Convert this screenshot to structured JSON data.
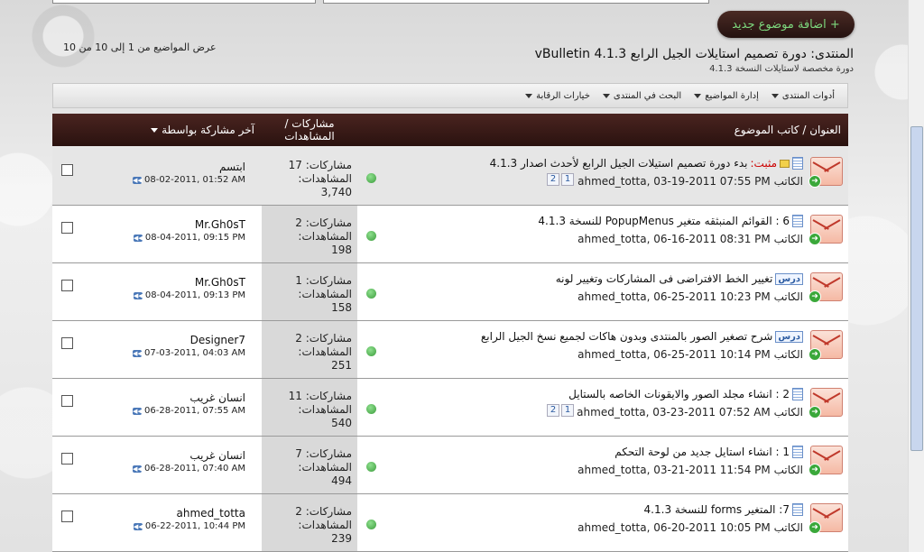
{
  "page": {
    "new_topic_label": "+ اضافة موضوع جديد",
    "forum_title": "المنتدى: دورة تصميم استايلات الجيل الرابع vBulletin 4.1.3",
    "forum_subtitle": "دورة مخصصة لاستايلات النسخة 4.1.3",
    "topic_count": "عرض المواضيع من 1 إلى 10 من 10"
  },
  "toolbar": {
    "items": [
      "أدوات المنتدى",
      "إدارة المواضيع",
      "البحث في المنتدى",
      "خيارات الرقابة"
    ]
  },
  "table": {
    "col_title": "العنوان / كاتب الموضوع",
    "col_stats": "مشاركات / المشاهدات",
    "col_lastpost": "آخر مشاركة بواسطة"
  },
  "rows": [
    {
      "prefix": "مثبت:",
      "title": "بدء دورة تصميم استيلات الجيل الرابع لأحدث اصدار 4.1.3",
      "author": "الكاتب ahmed_totta, 03-19-2011 07:55 PM",
      "pages": [
        "2",
        "1"
      ],
      "posts": "مشاركات: 17",
      "views_label": "المشاهدات:",
      "views": "3,740",
      "last_user": "ابتسم",
      "last_date": "08-02-2011, 01:52 AM"
    },
    {
      "prefix": "",
      "title": "6 : القوائم المنبثقه متغير PopupMenus للنسخة 4.1.3",
      "author": "الكاتب ahmed_totta, 06-16-2011 08:31 PM",
      "pages": [],
      "posts": "مشاركات: 2",
      "views_label": "المشاهدات:",
      "views": "198",
      "last_user": "Mr.Gh0sT",
      "last_date": "08-04-2011, 09:15 PM"
    },
    {
      "prefix": "درس",
      "title": "تغيير الخط الافتراضى فى المشاركات وتغيير لونه",
      "author": "الكاتب ahmed_totta, 06-25-2011 10:23 PM",
      "pages": [],
      "posts": "مشاركات: 1",
      "views_label": "المشاهدات:",
      "views": "158",
      "last_user": "Mr.Gh0sT",
      "last_date": "08-04-2011, 09:13 PM"
    },
    {
      "prefix": "درس",
      "title": "شرح تصغير الصور بالمنتدى وبدون هاكات لجميع نسخ الجيل الرابع",
      "author": "الكاتب ahmed_totta, 06-25-2011 10:14 PM",
      "pages": [],
      "posts": "مشاركات: 2",
      "views_label": "المشاهدات:",
      "views": "251",
      "last_user": "Designer7",
      "last_date": "07-03-2011, 04:03 AM"
    },
    {
      "prefix": "",
      "title": "2 : انشاء مجلد الصور والايقونات الخاصه بالستايل",
      "author": "الكاتب ahmed_totta, 03-23-2011 07:52 AM",
      "pages": [
        "2",
        "1"
      ],
      "posts": "مشاركات: 11",
      "views_label": "المشاهدات:",
      "views": "540",
      "last_user": "انسان غريب",
      "last_date": "06-28-2011, 07:55 AM"
    },
    {
      "prefix": "",
      "title": "1 : انشاء استايل جديد من لوحة التحكم",
      "author": "الكاتب ahmed_totta, 03-21-2011 11:54 PM",
      "pages": [],
      "posts": "مشاركات: 7",
      "views_label": "المشاهدات:",
      "views": "494",
      "last_user": "انسان غريب",
      "last_date": "06-28-2011, 07:40 AM"
    },
    {
      "prefix": "",
      "title": "7: المتغير forms للنسخة 4.1.3",
      "author": "الكاتب ahmed_totta, 06-20-2011 10:05 PM",
      "pages": [],
      "posts": "مشاركات: 2",
      "views_label": "المشاهدات:",
      "views": "239",
      "last_user": "ahmed_totta",
      "last_date": "06-22-2011, 10:44 PM"
    }
  ],
  "colors": {
    "header_bg": "#3a1a16",
    "accent_green": "#7dd87d",
    "sticky_red": "#cc0000"
  },
  "icons": [
    "envelope-icon",
    "doc-icon",
    "status-dot-icon",
    "go-to-post-icon",
    "caret-down-icon"
  ]
}
